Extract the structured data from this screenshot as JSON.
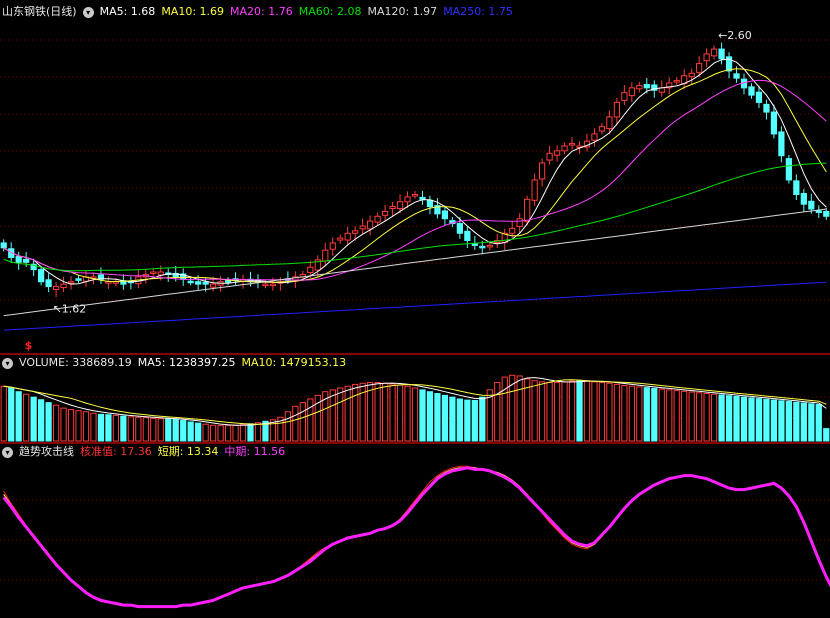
{
  "colors": {
    "background": "#000000",
    "grid": "#7a0000",
    "panel_border": "#b00000",
    "up": "#ff3b3b",
    "down": "#54ffff",
    "ma5": "#ffffff",
    "ma10": "#ffff40",
    "ma20": "#ff40ff",
    "ma60": "#00e000",
    "ma120": "#d8d8d8",
    "ma250": "#2020ff",
    "vol_ma5": "#ffffff",
    "vol_ma10": "#ffff40",
    "trend_base": "#ff2020",
    "trend_short": "#ffff40",
    "trend_mid": "#ff20ff",
    "signal": "#ff2020"
  },
  "price_header": {
    "title": "山东钢铁(日线)",
    "ma5": "MA5: 1.68",
    "ma10": "MA10: 1.69",
    "ma20": "MA20: 1.76",
    "ma60": "MA60: 2.08",
    "ma120": "MA120: 1.97",
    "ma250": "MA250: 1.75"
  },
  "volume_header": {
    "label": "VOLUME: 338689.19",
    "ma5": "MA5: 1238397.25",
    "ma10": "MA10: 1479153.13"
  },
  "indicator_header": {
    "title": "趋势攻击线",
    "base": "核准值: 17.36",
    "short": "短期: 13.34",
    "mid": "中期: 11.56"
  },
  "annotations": {
    "high_label": "2.60",
    "low_label": "1.62",
    "signal_glyph": "$"
  },
  "chart_data": [
    {
      "type": "candlestick",
      "title": "山东钢铁(日线)",
      "ylim": [
        1.35,
        2.72
      ],
      "series_names": [
        "MA5",
        "MA10",
        "MA20",
        "MA60",
        "MA120",
        "MA250"
      ],
      "closes": [
        1.78,
        1.74,
        1.72,
        1.72,
        1.69,
        1.64,
        1.62,
        1.62,
        1.63,
        1.64,
        1.65,
        1.66,
        1.66,
        1.65,
        1.64,
        1.64,
        1.63,
        1.64,
        1.66,
        1.67,
        1.68,
        1.68,
        1.67,
        1.66,
        1.65,
        1.64,
        1.63,
        1.63,
        1.63,
        1.64,
        1.64,
        1.65,
        1.65,
        1.64,
        1.64,
        1.63,
        1.63,
        1.64,
        1.65,
        1.66,
        1.67,
        1.7,
        1.73,
        1.77,
        1.8,
        1.82,
        1.84,
        1.85,
        1.87,
        1.89,
        1.91,
        1.93,
        1.95,
        1.97,
        1.99,
        2.0,
        1.98,
        1.95,
        1.92,
        1.9,
        1.88,
        1.84,
        1.81,
        1.79,
        1.78,
        1.79,
        1.81,
        1.84,
        1.86,
        1.9,
        1.98,
        2.06,
        2.13,
        2.17,
        2.18,
        2.2,
        2.21,
        2.2,
        2.22,
        2.25,
        2.28,
        2.32,
        2.38,
        2.42,
        2.44,
        2.45,
        2.44,
        2.43,
        2.44,
        2.46,
        2.47,
        2.49,
        2.5,
        2.54,
        2.58,
        2.6,
        2.56,
        2.51,
        2.48,
        2.44,
        2.41,
        2.38,
        2.34,
        2.25,
        2.16,
        2.06,
        2.0,
        1.96,
        1.94,
        1.93,
        1.91
      ]
    },
    {
      "type": "bar",
      "title": "VOLUME",
      "values": [
        1500000,
        1450000,
        1350000,
        1280000,
        1200000,
        1130000,
        1050000,
        980000,
        900000,
        860000,
        830000,
        800000,
        760000,
        730000,
        720000,
        700000,
        680000,
        660000,
        650000,
        640000,
        620000,
        610000,
        600000,
        590000,
        560000,
        520000,
        490000,
        460000,
        430000,
        420000,
        420000,
        430000,
        450000,
        470000,
        500000,
        540000,
        580000,
        650000,
        800000,
        950000,
        1050000,
        1150000,
        1250000,
        1350000,
        1400000,
        1450000,
        1500000,
        1550000,
        1580000,
        1600000,
        1600000,
        1580000,
        1560000,
        1530000,
        1500000,
        1450000,
        1400000,
        1350000,
        1300000,
        1250000,
        1200000,
        1150000,
        1120000,
        1110000,
        1200000,
        1400000,
        1600000,
        1750000,
        1800000,
        1780000,
        1700000,
        1650000,
        1620000,
        1600000,
        1600000,
        1620000,
        1640000,
        1660000,
        1650000,
        1620000,
        1600000,
        1580000,
        1550000,
        1520000,
        1500000,
        1480000,
        1460000,
        1440000,
        1420000,
        1400000,
        1380000,
        1360000,
        1340000,
        1320000,
        1300000,
        1280000,
        1260000,
        1240000,
        1220000,
        1200000,
        1180000,
        1160000,
        1140000,
        1120000,
        1100000,
        1080000,
        1060000,
        1040000,
        1020000,
        1000000,
        338689.19
      ],
      "ma5": 1238397.25,
      "ma10": 1479153.13
    },
    {
      "type": "line",
      "title": "趋势攻击线",
      "ylim": [
        0,
        100
      ],
      "series": [
        {
          "name": "核准值",
          "values": [
            80,
            72,
            65,
            58,
            52,
            46,
            40,
            34,
            28,
            23,
            19,
            15,
            12,
            10,
            9,
            8,
            7,
            7,
            6,
            6,
            6,
            6,
            6,
            6,
            7,
            7,
            8,
            9,
            10,
            12,
            14,
            16,
            18,
            19,
            20,
            21,
            22,
            24,
            26,
            29,
            33,
            37,
            41,
            44,
            46,
            48,
            50,
            51,
            52,
            53,
            55,
            56,
            58,
            62,
            68,
            74,
            80,
            86,
            90,
            93,
            95,
            96,
            96,
            95,
            94,
            93,
            92,
            90,
            87,
            83,
            78,
            72,
            66,
            60,
            55,
            50,
            46,
            44,
            43,
            46,
            51,
            57,
            63,
            69,
            74,
            78,
            81,
            84,
            86,
            88,
            89,
            90,
            90,
            89,
            88,
            86,
            84,
            82,
            81,
            81,
            82,
            83,
            84,
            85,
            82,
            77,
            70,
            60,
            48,
            36,
            25,
            16,
            10,
            6,
            3
          ]
        },
        {
          "name": "短期",
          "values": [
            78,
            71,
            64,
            57,
            51,
            45,
            39,
            33,
            28,
            23,
            19,
            15,
            12,
            10,
            9,
            8,
            7,
            7,
            6,
            6,
            6,
            6,
            6,
            6,
            7,
            7,
            8,
            9,
            10,
            12,
            14,
            16,
            18,
            19,
            20,
            21,
            22,
            24,
            26,
            29,
            32,
            36,
            40,
            43,
            46,
            48,
            50,
            51,
            52,
            53,
            55,
            56,
            58,
            62,
            67,
            73,
            79,
            84,
            89,
            92,
            94,
            95,
            95,
            95,
            94,
            93,
            92,
            90,
            87,
            83,
            78,
            72,
            67,
            61,
            56,
            51,
            47,
            45,
            44,
            46,
            51,
            57,
            63,
            69,
            74,
            78,
            81,
            84,
            86,
            88,
            89,
            90,
            90,
            89,
            88,
            86,
            84,
            82,
            81,
            81,
            82,
            83,
            84,
            85,
            82,
            77,
            70,
            60,
            48,
            36,
            25,
            16,
            10,
            6,
            3
          ]
        },
        {
          "name": "中期",
          "values": [
            76,
            70,
            63,
            57,
            51,
            45,
            39,
            33,
            28,
            23,
            19,
            15,
            12,
            10,
            9,
            8,
            7,
            7,
            6,
            6,
            6,
            6,
            6,
            6,
            7,
            7,
            8,
            9,
            10,
            12,
            14,
            16,
            18,
            19,
            20,
            21,
            22,
            24,
            26,
            29,
            32,
            35,
            39,
            43,
            46,
            48,
            50,
            51,
            52,
            53,
            55,
            56,
            58,
            61,
            66,
            72,
            78,
            83,
            88,
            91,
            93,
            94,
            95,
            94,
            94,
            93,
            91,
            89,
            86,
            82,
            77,
            72,
            67,
            62,
            57,
            52,
            48,
            46,
            45,
            47,
            52,
            57,
            63,
            69,
            74,
            78,
            81,
            84,
            86,
            88,
            89,
            90,
            90,
            89,
            88,
            86,
            84,
            82,
            81,
            81,
            82,
            83,
            84,
            85,
            82,
            77,
            70,
            60,
            48,
            36,
            25,
            16,
            10,
            6,
            3
          ]
        }
      ]
    }
  ]
}
